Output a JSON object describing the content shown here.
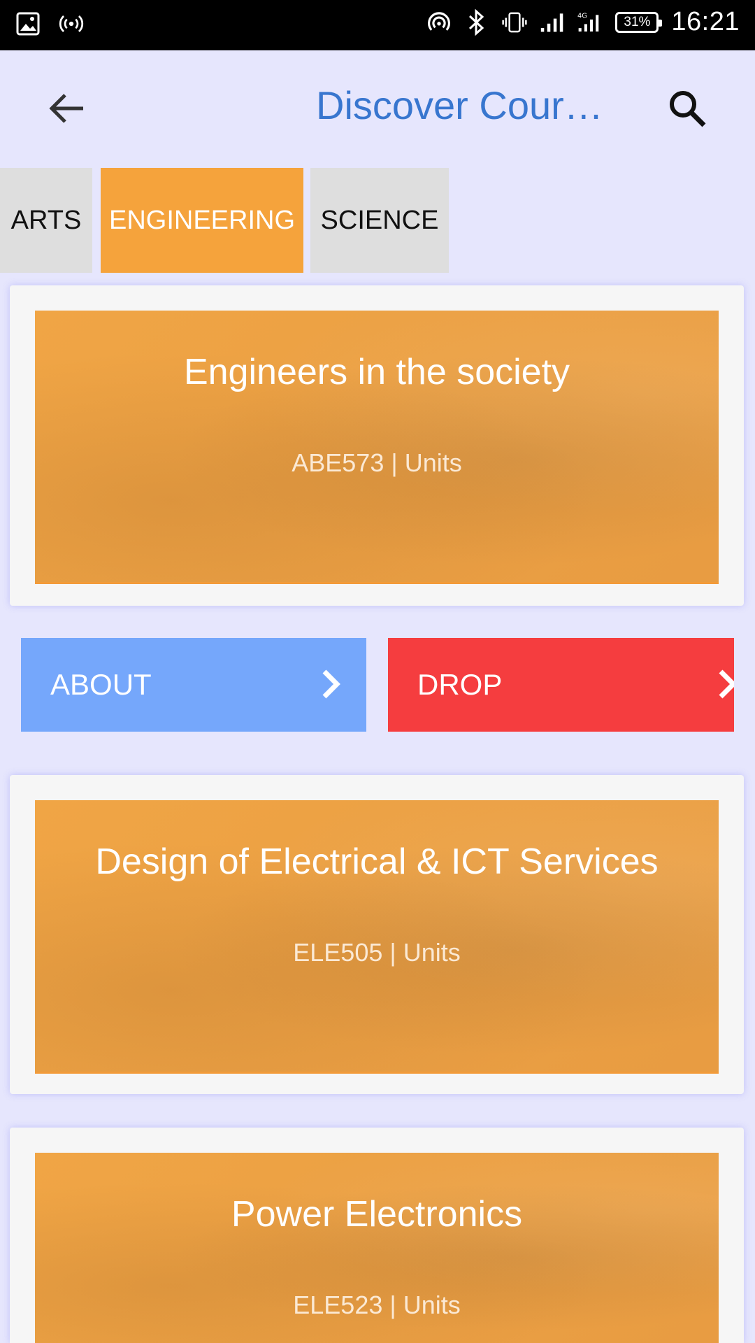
{
  "status_bar": {
    "time": "16:21",
    "battery": "31%",
    "left_icons": [
      "image-icon",
      "hotspot-icon"
    ],
    "right_icons": [
      "nfc-icon",
      "bluetooth-icon",
      "vibrate-icon",
      "signal-icon",
      "signal-4g-icon",
      "battery-icon"
    ]
  },
  "app_bar": {
    "title": "Discover Cour…",
    "back_icon": "arrow-back-icon",
    "search_icon": "search-icon",
    "title_color": "#3876cf"
  },
  "tabs": [
    {
      "label": "ARTS",
      "active": false
    },
    {
      "label": "ENGINEERING",
      "active": true
    },
    {
      "label": "SCIENCE",
      "active": false
    }
  ],
  "courses": [
    {
      "title": "Engineers in the society",
      "subtitle": "ABE573 | Units"
    },
    {
      "title": "Design of Electrical & ICT Services",
      "subtitle": "ELE505 | Units"
    },
    {
      "title": "Power Electronics",
      "subtitle": "ELE523 | Units"
    }
  ],
  "actions": {
    "about_label": "ABOUT",
    "drop_label": "DROP",
    "about_color": "#75a7fb",
    "drop_color": "#f53d3f"
  },
  "colors": {
    "background": "#e6e6fd",
    "tab_active": "#f5a33c",
    "tab_inactive": "#dedede",
    "banner": "#f0a545"
  }
}
